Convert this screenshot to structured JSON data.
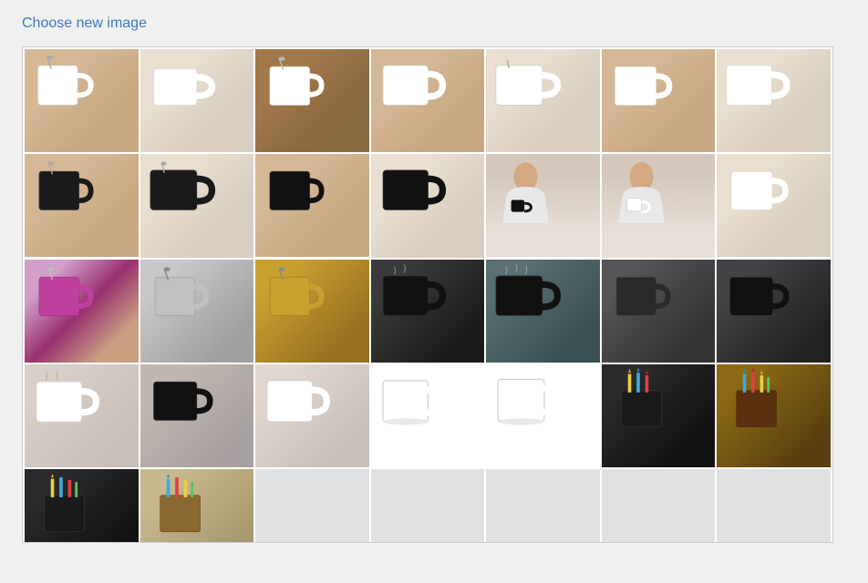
{
  "header": {
    "choose_link": "Choose new image"
  },
  "gallery": {
    "rows": [
      [
        {
          "id": "r1c1",
          "type": "white-mug",
          "bg": "bg-kitchen-warm",
          "desc": "White mug with spoon kitchen warm"
        },
        {
          "id": "r1c2",
          "type": "white-mug",
          "bg": "bg-kitchen-light",
          "desc": "White mug kitchen light"
        },
        {
          "id": "r1c3",
          "type": "white-mug",
          "bg": "bg-kitchen-wood",
          "desc": "White mug kitchen wood"
        },
        {
          "id": "r1c4",
          "type": "white-mug",
          "bg": "bg-kitchen-warm",
          "desc": "White mug warm 2"
        },
        {
          "id": "r1c5",
          "type": "white-mug",
          "bg": "bg-kitchen-light",
          "desc": "White mug light 2"
        },
        {
          "id": "r1c6",
          "type": "white-mug",
          "bg": "bg-kitchen-warm",
          "desc": "White mug warm 3"
        },
        {
          "id": "r1c7",
          "type": "white-mug",
          "bg": "bg-kitchen-light",
          "desc": "White mug light 3"
        }
      ],
      [
        {
          "id": "r2c1",
          "type": "black-mug",
          "bg": "bg-kitchen-warm",
          "desc": "Black mug spoon kitchen"
        },
        {
          "id": "r2c2",
          "type": "black-mug",
          "bg": "bg-kitchen-light",
          "desc": "Black mug kitchen light"
        },
        {
          "id": "r2c3",
          "type": "black-mug",
          "bg": "bg-kitchen-warm",
          "desc": "Black mug kitchen warm 2"
        },
        {
          "id": "r2c4",
          "type": "black-mug",
          "bg": "bg-kitchen-light",
          "desc": "Black mug light 2"
        },
        {
          "id": "r2c5",
          "type": "person-mug",
          "bg": "bg-person",
          "desc": "Person holding black mug"
        },
        {
          "id": "r2c6",
          "type": "person-mug-white",
          "bg": "bg-person",
          "desc": "Person holding white mug"
        },
        {
          "id": "r2c7",
          "type": "white-mug",
          "bg": "bg-kitchen-light",
          "desc": "White plain mug"
        }
      ],
      [
        {
          "id": "r3c1",
          "type": "magenta-mug",
          "bg": "bg-magenta-kitchen",
          "desc": "Magenta mug"
        },
        {
          "id": "r3c2",
          "type": "silver-mug",
          "bg": "bg-silver-kitchen",
          "desc": "Silver mug"
        },
        {
          "id": "r3c3",
          "type": "gold-mug",
          "bg": "bg-gold-kitchen",
          "desc": "Gold mug"
        },
        {
          "id": "r3c4",
          "type": "black-mug",
          "bg": "bg-black-steam",
          "desc": "Black mug steam"
        },
        {
          "id": "r3c5",
          "type": "black-mug",
          "bg": "bg-black-steam",
          "desc": "Black mug steam 2"
        },
        {
          "id": "r3c6",
          "type": "dark-mug",
          "bg": "bg-dark",
          "desc": "Dark mug"
        },
        {
          "id": "r3c7",
          "type": "black-mug",
          "bg": "bg-dark",
          "desc": "Black mug dark"
        }
      ],
      [
        {
          "id": "r4c1",
          "type": "white-mug-steam",
          "bg": "bg-white-cafe",
          "desc": "White mug with steam cafe"
        },
        {
          "id": "r4c2",
          "type": "black-mug",
          "bg": "bg-white-cafe",
          "desc": "Black mug cafe"
        },
        {
          "id": "r4c3",
          "type": "white-mug",
          "bg": "bg-white-cafe",
          "desc": "White mug cafe 2"
        },
        {
          "id": "r4c4",
          "type": "white-mug",
          "bg": "bg-white-clean",
          "desc": "White mug clean"
        },
        {
          "id": "r4c5",
          "type": "white-mug",
          "bg": "bg-white-clean",
          "desc": "White mug clean 2"
        },
        {
          "id": "r4c6",
          "type": "pencil-holder",
          "bg": "bg-pencil-dark",
          "desc": "Pencil holder dark mug"
        },
        {
          "id": "r4c7",
          "type": "pencil-holder",
          "bg": "bg-pencil-wood",
          "desc": "Pencil holder wood"
        }
      ],
      [
        {
          "id": "r5c1",
          "type": "pencil-holder",
          "bg": "bg-pencil-dark",
          "desc": "Pencil holder dark 2"
        },
        {
          "id": "r5c2",
          "type": "pencil-holder",
          "bg": "bg-kitchen-warm",
          "desc": "Pencil holder warm"
        },
        {
          "id": "r5c3",
          "type": "empty",
          "bg": "bg-kitchen-light",
          "desc": "Empty"
        },
        {
          "id": "r5c4",
          "type": "empty",
          "bg": "bg-kitchen-light",
          "desc": "Empty 2"
        },
        {
          "id": "r5c5",
          "type": "empty",
          "bg": "bg-kitchen-light",
          "desc": "Empty 3"
        },
        {
          "id": "r5c6",
          "type": "empty",
          "bg": "bg-kitchen-light",
          "desc": "Empty 4"
        },
        {
          "id": "r5c7",
          "type": "empty",
          "bg": "bg-kitchen-light",
          "desc": "Empty 5"
        }
      ]
    ]
  }
}
